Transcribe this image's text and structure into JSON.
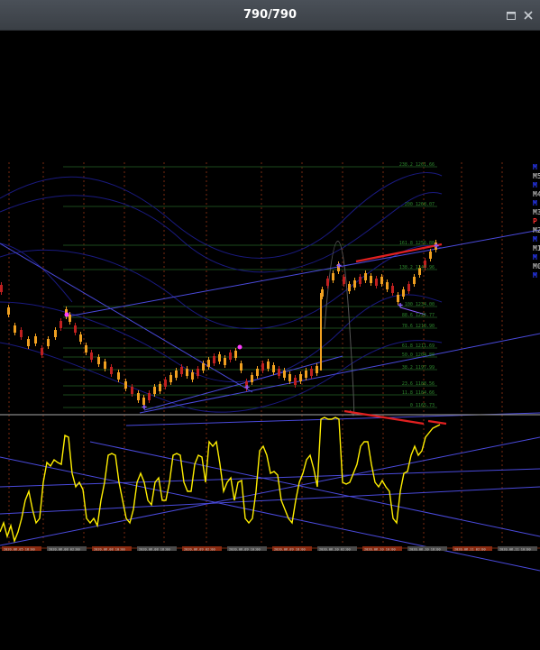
{
  "window": {
    "title": "790/790",
    "maximize_icon": "maximize-icon",
    "close_icon": "close-icon"
  },
  "colors": {
    "background": "#000000",
    "candle_up": "#f0a020",
    "candle_down": "#c02020",
    "oscillator": "#ffee00",
    "trendline": "#4a4adc",
    "divergence": "#e02020",
    "fib_grid": "#1c4a1c",
    "session_line": "#7a2a10"
  },
  "fib_labels": [
    "238.2 1261.66",
    "200 1268.07",
    "161.8 1256.88",
    "138.2 1247.96",
    "100 1234.00",
    "88.6 1226.77",
    "78.6 1218.90",
    "61.8 1211.69",
    "50.0 1204.80",
    "38.2 1197.99",
    "23.6 1188.56",
    "11.8 1184.66",
    "0 1165.73"
  ],
  "right_labels": [
    "M",
    "M5",
    "M",
    "M4",
    "M",
    "M3",
    "P",
    "M2",
    "M",
    "M1",
    "M",
    "M0",
    "M"
  ],
  "time_labels": [
    "2020.06.05 18:00",
    "2020.06.08 02:00",
    "2020.06.08 10:00",
    "2020.06.08 18:00",
    "2020.06.09 02:00",
    "2020.06.09 10:00",
    "2020.06.09 18:00",
    "2020.06.10 02:00",
    "2020.06.10 10:00",
    "2020.06.10 18:00",
    "2020.06.11 02:00",
    "2020.06.11 10:00"
  ]
}
